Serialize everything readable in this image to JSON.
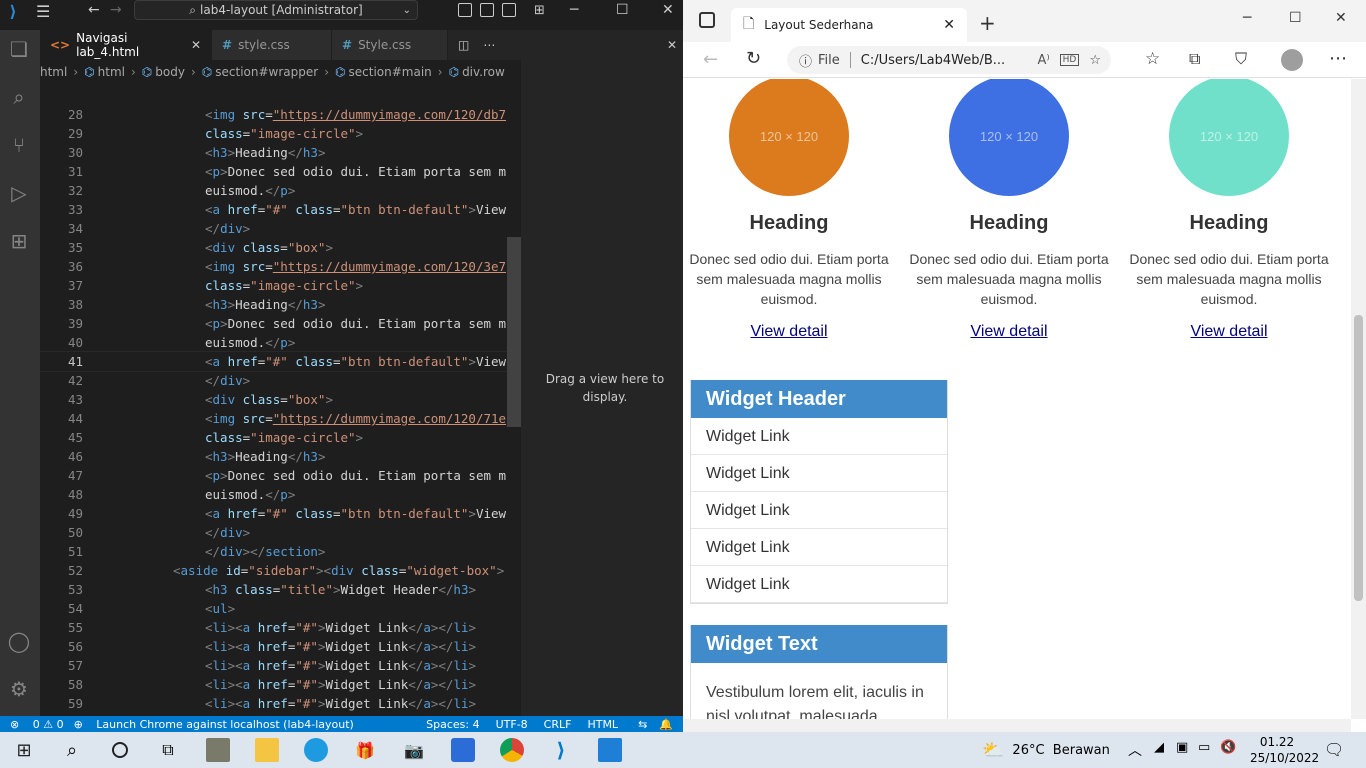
{
  "vscode": {
    "title": "lab4-layout [Administrator]",
    "tabs": [
      {
        "label": "Navigasi lab_4.html",
        "type": "html"
      },
      {
        "label": "style.css",
        "type": "css"
      },
      {
        "label": "Style.css",
        "type": "css"
      }
    ],
    "breadcrumbs": [
      "html",
      "html",
      "body",
      "section#wrapper",
      "section#main",
      "div.row"
    ],
    "drag_hint": "Drag a view here to display.",
    "status": {
      "problems": "0 ⚠ 0",
      "launch": "Launch Chrome against localhost (lab4-layout)",
      "spaces": "Spaces: 4",
      "encoding": "UTF-8",
      "eol": "CRLF",
      "language": "HTML"
    },
    "current_line": "41",
    "code_lines": [
      {
        "n": "28",
        "indent": 2,
        "html": "<span class=\"t\">&lt;</span><span class=\"tg\">img</span> <span class=\"at\">src</span>=<span class=\"url\">\"https://dummyimage.com/120/db7</span>"
      },
      {
        "n": "29",
        "indent": 2,
        "html": "<span class=\"at\">class</span>=<span class=\"st\">\"image-circle\"</span><span class=\"t\">&gt;</span>"
      },
      {
        "n": "30",
        "indent": 2,
        "html": "<span class=\"t\">&lt;</span><span class=\"tg\">h3</span><span class=\"t\">&gt;</span>Heading<span class=\"t\">&lt;/</span><span class=\"tg\">h3</span><span class=\"t\">&gt;</span>"
      },
      {
        "n": "31",
        "indent": 2,
        "html": "<span class=\"t\">&lt;</span><span class=\"tg\">p</span><span class=\"t\">&gt;</span>Donec sed odio dui. Etiam porta sem m"
      },
      {
        "n": "32",
        "indent": 2,
        "html": "euismod.<span class=\"t\">&lt;/</span><span class=\"tg\">p</span><span class=\"t\">&gt;</span>"
      },
      {
        "n": "33",
        "indent": 2,
        "html": "<span class=\"t\">&lt;</span><span class=\"tg\">a</span> <span class=\"at\">href</span>=<span class=\"st\">\"#\"</span> <span class=\"at\">class</span>=<span class=\"st\">\"btn btn-default\"</span><span class=\"t\">&gt;</span>View"
      },
      {
        "n": "34",
        "indent": 2,
        "html": "<span class=\"t\">&lt;/</span><span class=\"tg\">div</span><span class=\"t\">&gt;</span>"
      },
      {
        "n": "35",
        "indent": 2,
        "html": "<span class=\"t\">&lt;</span><span class=\"tg\">div</span> <span class=\"at\">class</span>=<span class=\"st\">\"box\"</span><span class=\"t\">&gt;</span>"
      },
      {
        "n": "36",
        "indent": 2,
        "html": "<span class=\"t\">&lt;</span><span class=\"tg\">img</span> <span class=\"at\">src</span>=<span class=\"url\">\"https://dummyimage.com/120/3e7</span>"
      },
      {
        "n": "37",
        "indent": 2,
        "html": "<span class=\"at\">class</span>=<span class=\"st\">\"image-circle\"</span><span class=\"t\">&gt;</span>"
      },
      {
        "n": "38",
        "indent": 2,
        "html": "<span class=\"t\">&lt;</span><span class=\"tg\">h3</span><span class=\"t\">&gt;</span>Heading<span class=\"t\">&lt;/</span><span class=\"tg\">h3</span><span class=\"t\">&gt;</span>"
      },
      {
        "n": "39",
        "indent": 2,
        "html": "<span class=\"t\">&lt;</span><span class=\"tg\">p</span><span class=\"t\">&gt;</span>Donec sed odio dui. Etiam porta sem m"
      },
      {
        "n": "40",
        "indent": 2,
        "html": "euismod.<span class=\"t\">&lt;/</span><span class=\"tg\">p</span><span class=\"t\">&gt;</span>"
      },
      {
        "n": "41",
        "indent": 2,
        "html": "<span class=\"t\">&lt;</span><span class=\"tg\">a</span> <span class=\"at\">href</span>=<span class=\"st\">\"#\"</span> <span class=\"at\">class</span>=<span class=\"st\">\"btn btn-default\"</span><span class=\"t\">&gt;</span>View"
      },
      {
        "n": "42",
        "indent": 2,
        "html": "<span class=\"t\">&lt;/</span><span class=\"tg\">div</span><span class=\"t\">&gt;</span>"
      },
      {
        "n": "43",
        "indent": 2,
        "html": "<span class=\"t\">&lt;</span><span class=\"tg\">div</span> <span class=\"at\">class</span>=<span class=\"st\">\"box\"</span><span class=\"t\">&gt;</span>"
      },
      {
        "n": "44",
        "indent": 2,
        "html": "<span class=\"t\">&lt;</span><span class=\"tg\">img</span> <span class=\"at\">src</span>=<span class=\"url\">\"https://dummyimage.com/120/71e</span>"
      },
      {
        "n": "45",
        "indent": 2,
        "html": "<span class=\"at\">class</span>=<span class=\"st\">\"image-circle\"</span><span class=\"t\">&gt;</span>"
      },
      {
        "n": "46",
        "indent": 2,
        "html": "<span class=\"t\">&lt;</span><span class=\"tg\">h3</span><span class=\"t\">&gt;</span>Heading<span class=\"t\">&lt;/</span><span class=\"tg\">h3</span><span class=\"t\">&gt;</span>"
      },
      {
        "n": "47",
        "indent": 2,
        "html": "<span class=\"t\">&lt;</span><span class=\"tg\">p</span><span class=\"t\">&gt;</span>Donec sed odio dui. Etiam porta sem m"
      },
      {
        "n": "48",
        "indent": 2,
        "html": "euismod.<span class=\"t\">&lt;/</span><span class=\"tg\">p</span><span class=\"t\">&gt;</span>"
      },
      {
        "n": "49",
        "indent": 2,
        "html": "<span class=\"t\">&lt;</span><span class=\"tg\">a</span> <span class=\"at\">href</span>=<span class=\"st\">\"#\"</span> <span class=\"at\">class</span>=<span class=\"st\">\"btn btn-default\"</span><span class=\"t\">&gt;</span>View"
      },
      {
        "n": "50",
        "indent": 2,
        "html": "<span class=\"t\">&lt;/</span><span class=\"tg\">div</span><span class=\"t\">&gt;</span>"
      },
      {
        "n": "51",
        "indent": 2,
        "html": "<span class=\"t\">&lt;/</span><span class=\"tg\">div</span><span class=\"t\">&gt;&lt;/</span><span class=\"tg\">section</span><span class=\"t\">&gt;</span>"
      },
      {
        "n": "52",
        "indent": 1,
        "html": "<span class=\"t\">&lt;</span><span class=\"tg\">aside</span> <span class=\"at\">id</span>=<span class=\"st\">\"sidebar\"</span><span class=\"t\">&gt;&lt;</span><span class=\"tg\">div</span> <span class=\"at\">class</span>=<span class=\"st\">\"widget-box\"</span><span class=\"t\">&gt;</span>"
      },
      {
        "n": "53",
        "indent": 2,
        "html": "<span class=\"t\">&lt;</span><span class=\"tg\">h3</span> <span class=\"at\">class</span>=<span class=\"st\">\"title\"</span><span class=\"t\">&gt;</span>Widget Header<span class=\"t\">&lt;/</span><span class=\"tg\">h3</span><span class=\"t\">&gt;</span>"
      },
      {
        "n": "54",
        "indent": 2,
        "html": "<span class=\"t\">&lt;</span><span class=\"tg\">ul</span><span class=\"t\">&gt;</span>"
      },
      {
        "n": "55",
        "indent": 2,
        "html": "<span class=\"t\">&lt;</span><span class=\"tg\">li</span><span class=\"t\">&gt;&lt;</span><span class=\"tg\">a</span> <span class=\"at\">href</span>=<span class=\"st\">\"#\"</span><span class=\"t\">&gt;</span>Widget Link<span class=\"t\">&lt;/</span><span class=\"tg\">a</span><span class=\"t\">&gt;&lt;/</span><span class=\"tg\">li</span><span class=\"t\">&gt;</span>"
      },
      {
        "n": "56",
        "indent": 2,
        "html": "<span class=\"t\">&lt;</span><span class=\"tg\">li</span><span class=\"t\">&gt;&lt;</span><span class=\"tg\">a</span> <span class=\"at\">href</span>=<span class=\"st\">\"#\"</span><span class=\"t\">&gt;</span>Widget Link<span class=\"t\">&lt;/</span><span class=\"tg\">a</span><span class=\"t\">&gt;&lt;/</span><span class=\"tg\">li</span><span class=\"t\">&gt;</span>"
      },
      {
        "n": "57",
        "indent": 2,
        "html": "<span class=\"t\">&lt;</span><span class=\"tg\">li</span><span class=\"t\">&gt;&lt;</span><span class=\"tg\">a</span> <span class=\"at\">href</span>=<span class=\"st\">\"#\"</span><span class=\"t\">&gt;</span>Widget Link<span class=\"t\">&lt;/</span><span class=\"tg\">a</span><span class=\"t\">&gt;&lt;/</span><span class=\"tg\">li</span><span class=\"t\">&gt;</span>"
      },
      {
        "n": "58",
        "indent": 2,
        "html": "<span class=\"t\">&lt;</span><span class=\"tg\">li</span><span class=\"t\">&gt;&lt;</span><span class=\"tg\">a</span> <span class=\"at\">href</span>=<span class=\"st\">\"#\"</span><span class=\"t\">&gt;</span>Widget Link<span class=\"t\">&lt;/</span><span class=\"tg\">a</span><span class=\"t\">&gt;&lt;/</span><span class=\"tg\">li</span><span class=\"t\">&gt;</span>"
      },
      {
        "n": "59",
        "indent": 2,
        "html": "<span class=\"t\">&lt;</span><span class=\"tg\">li</span><span class=\"t\">&gt;&lt;</span><span class=\"tg\">a</span> <span class=\"at\">href</span>=<span class=\"st\">\"#\"</span><span class=\"t\">&gt;</span>Widget Link<span class=\"t\">&lt;/</span><span class=\"tg\">a</span><span class=\"t\">&gt;&lt;/</span><span class=\"tg\">li</span><span class=\"t\">&gt;</span>"
      }
    ]
  },
  "browser": {
    "tab_title": "Layout Sederhana",
    "url_scheme": "File",
    "url": "C:/Users/Lab4Web/B...",
    "boxes": [
      {
        "circle_color": "#db7b1e",
        "circle_label": "120 × 120",
        "heading": "Heading",
        "text": "Donec sed odio dui. Etiam porta sem malesuada magna mollis euismod.",
        "link": "View detail"
      },
      {
        "circle_color": "#3e6fe3",
        "circle_label": "120 × 120",
        "heading": "Heading",
        "text": "Donec sed odio dui. Etiam porta sem malesuada magna mollis euismod.",
        "link": "View detail"
      },
      {
        "circle_color": "#71e0cb",
        "circle_label": "120 × 120",
        "heading": "Heading",
        "text": "Donec sed odio dui. Etiam porta sem malesuada magna mollis euismod.",
        "link": "View detail"
      }
    ],
    "widget1": {
      "header": "Widget Header",
      "links": [
        "Widget Link",
        "Widget Link",
        "Widget Link",
        "Widget Link",
        "Widget Link"
      ]
    },
    "widget2": {
      "header": "Widget Text",
      "text": "Vestibulum lorem elit, iaculis in nisl volutpat, malesuada tincidunt"
    }
  },
  "taskbar": {
    "weather": "26°C  Berawan",
    "time": "01.22",
    "date": "25/10/2022"
  }
}
